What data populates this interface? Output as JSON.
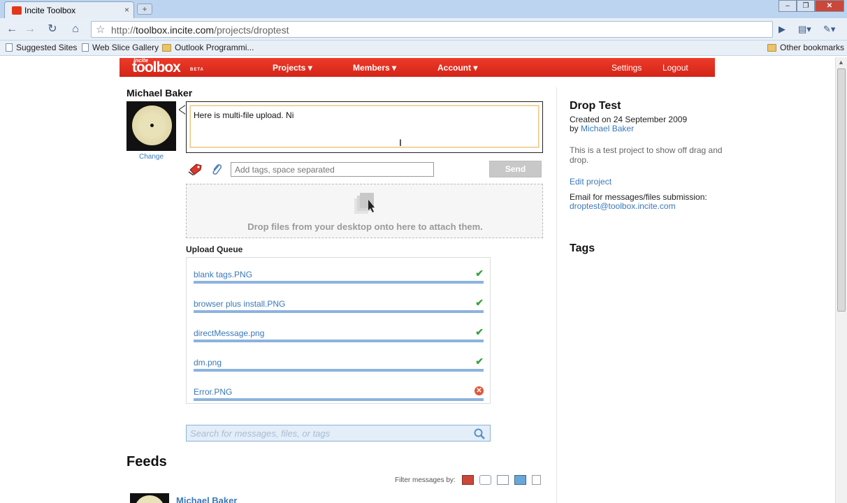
{
  "browser": {
    "tab_title": "Incite Toolbox",
    "tab_close": "×",
    "url_scheme": "http://",
    "url_host": "toolbox.incite.com",
    "url_path": "/projects/droptest",
    "bookmarks": [
      "Suggested Sites",
      "Web Slice Gallery",
      "Outlook Programmi...",
      "Other bookmarks"
    ]
  },
  "site": {
    "logo_small": "incite",
    "logo": "toolbox",
    "logo_beta": "BETA",
    "nav": [
      "Projects ▾",
      "Members ▾",
      "Account ▾"
    ],
    "nav_right": [
      "Settings",
      "Logout"
    ]
  },
  "user": {
    "name": "Michael Baker",
    "change_label": "Change"
  },
  "composer": {
    "message_value": "Here is multi-file upload. Ni",
    "tags_placeholder": "Add tags, space separated",
    "send_label": "Send",
    "drop_text": "Drop files from your desktop onto here to attach them."
  },
  "upload_queue": {
    "title": "Upload Queue",
    "items": [
      {
        "name": "blank tags.PNG",
        "status": "done",
        "progress": 1.0
      },
      {
        "name": "browser plus install.PNG",
        "status": "done",
        "progress": 1.0
      },
      {
        "name": "directMessage.png",
        "status": "done",
        "progress": 1.0
      },
      {
        "name": "dm.png",
        "status": "done",
        "progress": 1.0
      },
      {
        "name": "Error.PNG",
        "status": "error",
        "progress": 1.0
      }
    ],
    "done_glyph": "✔",
    "error_glyph": "✕"
  },
  "search": {
    "placeholder": "Search for messages, files, or tags"
  },
  "feeds": {
    "title": "Feeds",
    "filter_label": "Filter messages by:",
    "first_author": "Michael Baker"
  },
  "project": {
    "title": "Drop Test",
    "created": "Created on 24 September 2009",
    "by_prefix": "by",
    "by_name": "Michael Baker",
    "description": "This is a test project to show off drag and drop.",
    "edit_label": "Edit project",
    "email_label": "Email for messages/files submission:",
    "email": "droptest@toolbox.incite.com",
    "tags_title": "Tags"
  },
  "colors": {
    "brand_red": "#e2301f",
    "link_blue": "#3a78b9",
    "progress_blue": "#8db3dd",
    "success_green": "#3aa53a",
    "error_red": "#e0573a"
  }
}
